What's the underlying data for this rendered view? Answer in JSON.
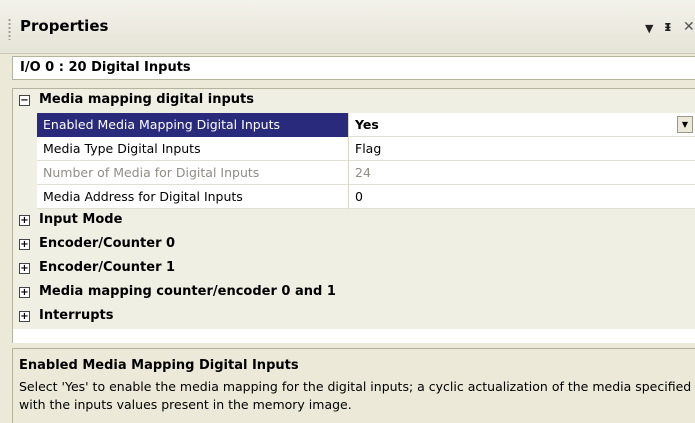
{
  "panel": {
    "title": "Properties",
    "dropdown_glyph": "▼",
    "pin_glyph": "ᵻ",
    "close_glyph": "✕"
  },
  "object_selector": "I/O 0 : 20 Digital Inputs",
  "grid": {
    "category_open": {
      "expander": "⊟",
      "label": "Media mapping digital inputs"
    },
    "properties": [
      {
        "name": "Enabled Media Mapping Digital Inputs",
        "value": "Yes"
      },
      {
        "name": "Media Type Digital Inputs",
        "value": "Flag"
      },
      {
        "name": "Number of Media for Digital Inputs",
        "value": "24"
      },
      {
        "name": "Media Address for Digital Inputs",
        "value": "0"
      }
    ],
    "collapsed_expander": "⊞",
    "collapsed_categories": [
      "Input Mode",
      "Encoder/Counter 0",
      "Encoder/Counter 1",
      "Media mapping counter/encoder 0 and 1",
      "Interrupts"
    ]
  },
  "description": {
    "title": "Enabled Media Mapping Digital Inputs",
    "text": "Select 'Yes' to enable the media mapping for the digital inputs; a cyclic actualization of the media specified with the inputs values present in the memory image."
  },
  "colors": {
    "selection": "#2a2a7c",
    "panel_bg": "#ece9d8"
  }
}
